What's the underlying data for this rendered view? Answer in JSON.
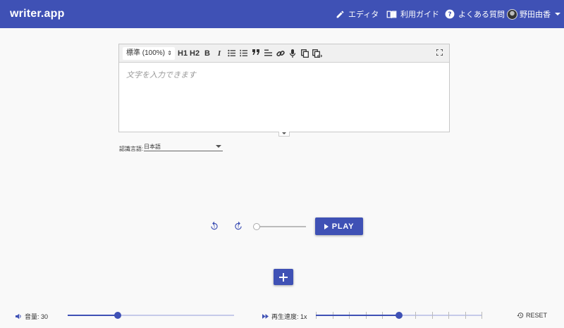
{
  "header": {
    "brand": "writer.app",
    "nav": {
      "editor": "エディタ",
      "guide": "利用ガイド",
      "faq": "よくある質問",
      "user": "野田由香"
    },
    "color": "#3f51b5"
  },
  "editor": {
    "size_select": "標準 (100%)",
    "heading1": "H1",
    "heading2": "H2",
    "bold": "B",
    "italic": "I",
    "placeholder": "文字を入力できます",
    "toolbar_icons": [
      "bullet-list-icon",
      "numbered-list-icon",
      "quote-icon",
      "align-icon",
      "link-icon",
      "mic-icon",
      "copy-icon",
      "copy-code-icon",
      "fullscreen-icon"
    ]
  },
  "language": {
    "label": "認識言語:",
    "value": "日本語"
  },
  "player": {
    "play_label": "PLAY",
    "seek_value": 0
  },
  "bottom": {
    "volume_label": "音量: 30",
    "volume_fraction": 0.3,
    "speed_label": "再生速度: 1x",
    "speed_fraction": 0.5,
    "speed_steps": 11,
    "reset_label": "RESET"
  }
}
